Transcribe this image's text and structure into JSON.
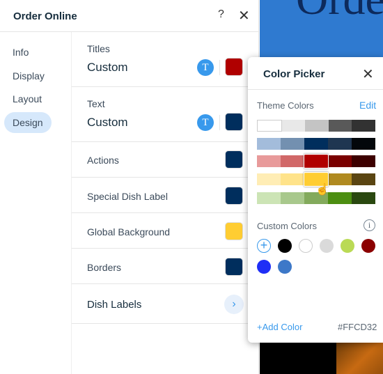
{
  "background": {
    "heading_fragment": "Orde"
  },
  "panel": {
    "title": "Order Online",
    "help_label": "?",
    "close_label": "✕"
  },
  "sidebar": {
    "items": [
      {
        "label": "Info"
      },
      {
        "label": "Display"
      },
      {
        "label": "Layout"
      },
      {
        "label": "Design",
        "active": true
      }
    ]
  },
  "design": {
    "titles": {
      "label": "Titles",
      "value": "Custom",
      "color": "#B00000"
    },
    "text": {
      "label": "Text",
      "value": "Custom",
      "color": "#002E5D"
    },
    "actions": {
      "label": "Actions",
      "color": "#002E5D"
    },
    "special": {
      "label": "Special Dish Label",
      "color": "#002E5D"
    },
    "global_bg": {
      "label": "Global Background",
      "color": "#FFCD32"
    },
    "borders": {
      "label": "Borders",
      "color": "#002E5D"
    },
    "dish_labels": {
      "label": "Dish Labels",
      "chevron": "›"
    },
    "text_icon": "T"
  },
  "picker": {
    "title": "Color Picker",
    "close_label": "✕",
    "theme_label": "Theme Colors",
    "edit_label": "Edit",
    "theme_rows": [
      [
        "#FFFFFF",
        "#E8E8E8",
        "#C4C4C4",
        "#595959",
        "#323232"
      ],
      [
        "#A3BCDB",
        "#7390B0",
        "#002E5D",
        "#1F3651",
        "#03070B"
      ],
      [
        "#E89A9A",
        "#D16868",
        "#B00000",
        "#7A0000",
        "#3D0000"
      ],
      [
        "#FFEDB5",
        "#FFE38A",
        "#FFCD32",
        "#B08A20",
        "#5A4512"
      ],
      [
        "#CCE4B5",
        "#A8C88C",
        "#83AA5C",
        "#4C8E11",
        "#2A4810"
      ]
    ],
    "selected": {
      "row": 3,
      "col": 2
    },
    "custom_label": "Custom Colors",
    "info_icon": "i",
    "custom_colors": [
      "#000000",
      "#FFFFFF",
      "#DADADA",
      "#BADA55",
      "#8B0000",
      "#1F2EF6",
      "#3D78C8"
    ],
    "add_custom_icon": "+",
    "add_color_label": "+Add Color",
    "hex_value": "#FFCD32"
  }
}
